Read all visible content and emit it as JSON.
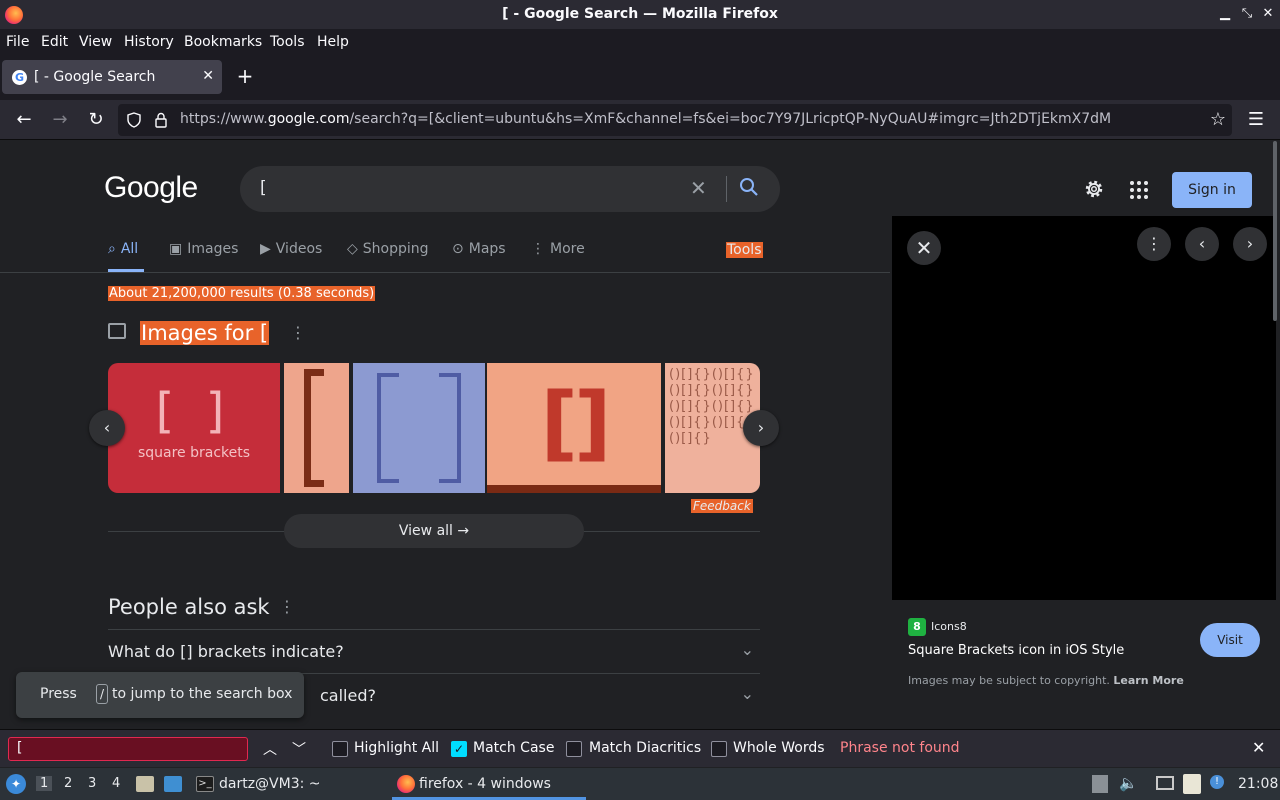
{
  "window": {
    "title": "[ - Google Search — Mozilla Firefox",
    "buttons": [
      "minimize-icon",
      "restore-icon",
      "close-icon"
    ]
  },
  "menu": [
    "File",
    "Edit",
    "View",
    "History",
    "Bookmarks",
    "Tools",
    "Help"
  ],
  "tab": {
    "title": "[ - Google Search",
    "close": "✕",
    "new": "+"
  },
  "urlbar": {
    "prefix": "https://www.",
    "domain": "google.com",
    "rest": "/search?q=[&client=ubuntu&hs=XmF&channel=fs&ei=boc7Y97JLricptQP-NyQuAU#imgrc=Jth2DTjEkmX7dM"
  },
  "google": {
    "logo": "Google",
    "query": "[",
    "sign_in": "Sign in",
    "tabs": [
      "All",
      "Images",
      "Videos",
      "Shopping",
      "Maps",
      "More"
    ],
    "tools": "Tools",
    "stats": "About 21,200,000 results (0.38 seconds)",
    "images_heading": "Images for [",
    "image_caption": "square brackets",
    "feedback": "Feedback",
    "view_all": "View all",
    "people_also_ask": "People also ask",
    "questions": [
      "What do [] brackets indicate?",
      "called?"
    ],
    "toast": {
      "press": "Press",
      "key": "/",
      "rest": "to jump to the search box"
    }
  },
  "side_panel": {
    "source": "Icons8",
    "title": "Square Brackets icon in iOS Style",
    "visit": "Visit",
    "copyright": "Images may be subject to copyright.",
    "learn_more": "Learn More"
  },
  "findbar": {
    "value": "[",
    "highlight_all": "Highlight All",
    "match_case": "Match Case",
    "match_diacritics": "Match Diacritics",
    "whole_words": "Whole Words",
    "status": "Phrase not found",
    "match_case_checked": true
  },
  "taskbar": {
    "workspaces": [
      "1",
      "2",
      "3",
      "4"
    ],
    "terminal": "dartz@VM3: ~",
    "firefox": "firefox - 4 windows",
    "clock": "21:08"
  },
  "colors": {
    "highlight": "#e8632a",
    "accent_blue": "#8ab4f8",
    "page_bg": "#202124"
  }
}
